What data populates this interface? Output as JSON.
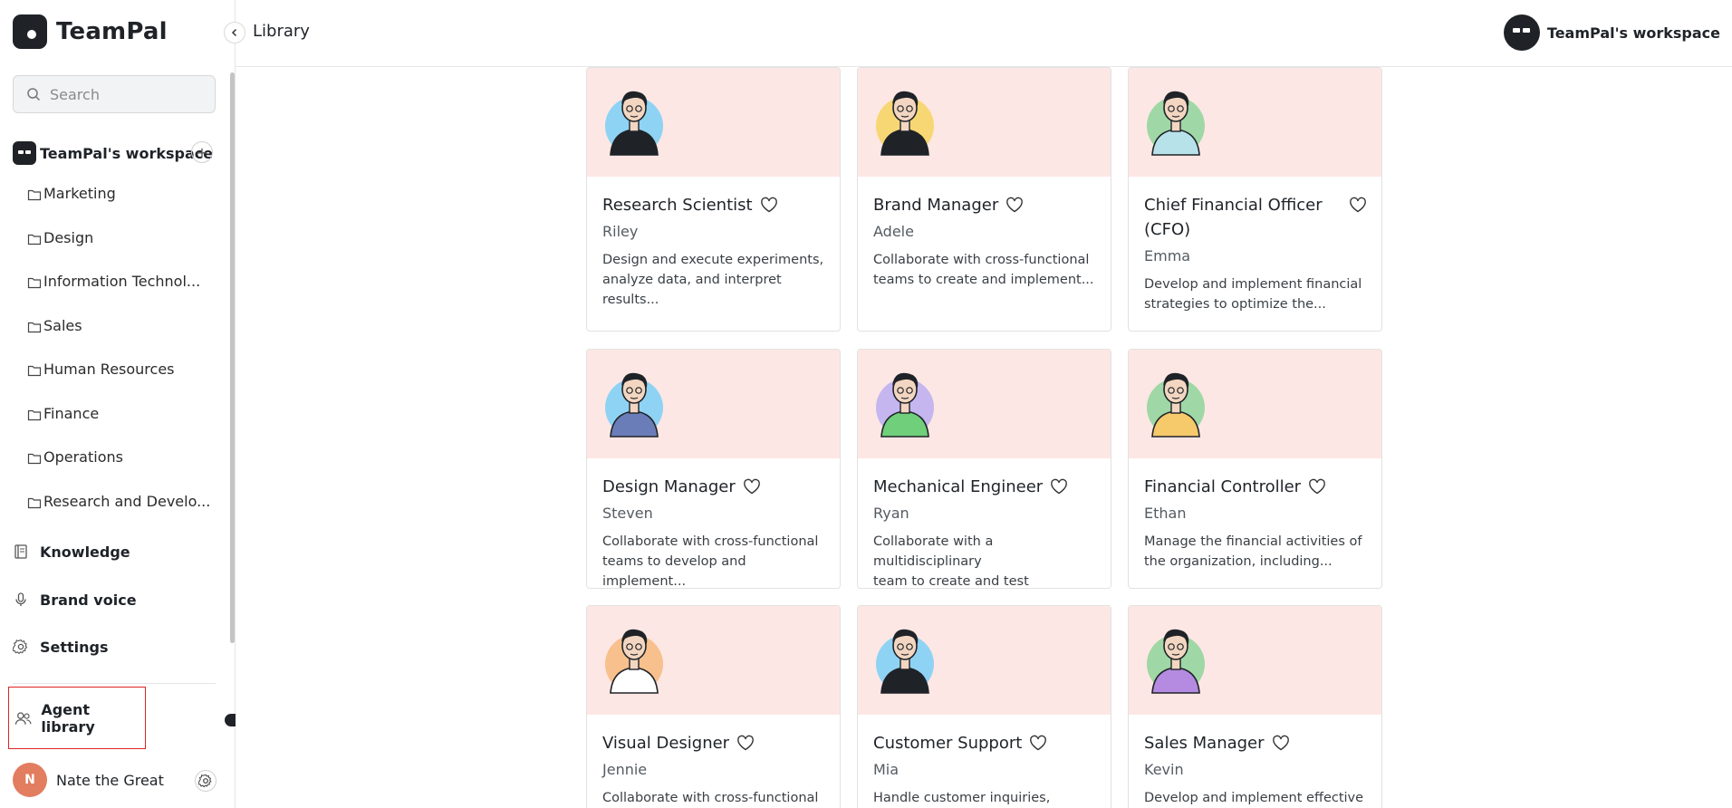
{
  "app": {
    "brand_name": "TeamPal"
  },
  "header": {
    "page_title": "Library",
    "workspace_name": "TeamPal's workspace"
  },
  "sidebar": {
    "search_placeholder": "Search",
    "workspace_name": "TeamPal's workspace",
    "folders": [
      "Marketing",
      "Design",
      "Information Technol...",
      "Sales",
      "Human Resources",
      "Finance",
      "Operations",
      "Research and Develo..."
    ],
    "nav": {
      "knowledge": "Knowledge",
      "brand_voice": "Brand voice",
      "settings": "Settings",
      "agent_library": "Agent library"
    },
    "user": {
      "initial": "N",
      "name": "Nate the Great"
    }
  },
  "agents": [
    {
      "title": "Research Scientist",
      "author": "Riley",
      "desc_lines": [
        "Design and execute experiments,",
        "analyze data, and interpret results..."
      ],
      "avatar_bg": "#8fd3f4",
      "shirt": "#1f2328"
    },
    {
      "title": "Brand Manager",
      "author": "Adele",
      "desc_lines": [
        "Collaborate with cross-functional",
        "teams to create and implement..."
      ],
      "avatar_bg": "#f7d774",
      "shirt": "#1f2328"
    },
    {
      "title": "Chief Financial Officer (CFO)",
      "author": "Emma",
      "desc_lines": [
        "Develop and implement financial",
        "strategies to optimize the..."
      ],
      "avatar_bg": "#9fd8a6",
      "shirt": "#b8e2ea"
    },
    {
      "title": "Design Manager",
      "author": "Steven",
      "desc_lines": [
        "Collaborate with cross-functional",
        "teams to develop and implement..."
      ],
      "avatar_bg": "#8fd3f4",
      "shirt": "#6b7db8"
    },
    {
      "title": "Mechanical Engineer",
      "author": "Ryan",
      "desc_lines": [
        "Collaborate with a multidisciplinary",
        "team to create and test prototypes..."
      ],
      "avatar_bg": "#c5b6f0",
      "shirt": "#6fcf7a"
    },
    {
      "title": "Financial Controller",
      "author": "Ethan",
      "desc_lines": [
        "Manage the financial activities of",
        "the organization, including..."
      ],
      "avatar_bg": "#9fd8a6",
      "shirt": "#f6c96b"
    },
    {
      "title": "Visual Designer",
      "author": "Jennie",
      "desc_lines": [
        "Collaborate with cross-functional"
      ],
      "avatar_bg": "#f8c08c",
      "shirt": "#ffffff"
    },
    {
      "title": "Customer Support",
      "author": "Mia",
      "desc_lines": [
        "Handle customer inquiries,"
      ],
      "avatar_bg": "#8fd3f4",
      "shirt": "#1f2328"
    },
    {
      "title": "Sales Manager",
      "author": "Kevin",
      "desc_lines": [
        "Develop and implement effective"
      ],
      "avatar_bg": "#9fd8a6",
      "shirt": "#b48be0"
    }
  ]
}
